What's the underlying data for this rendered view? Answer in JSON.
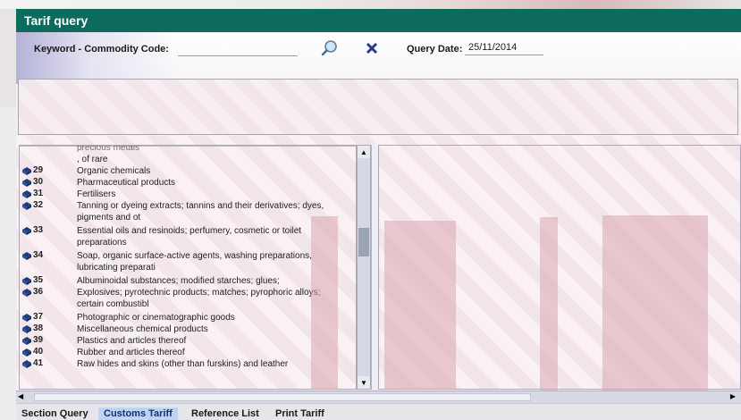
{
  "window": {
    "title": "Tarif query"
  },
  "search": {
    "keyword_label": "Keyword - Commodity Code:",
    "keyword_value": "",
    "query_date_label": "Query Date:",
    "query_date_value": "25/11/2014"
  },
  "colors": {
    "titlebar": "#0d6b5e",
    "active_tab": "#bfd3f3"
  },
  "icons": {
    "search": "magnifier-icon",
    "clear": "clear-x-icon",
    "row": "book-icon"
  },
  "chapters": [
    {
      "code": "",
      "text": "precious metals",
      "partial": true
    },
    {
      "code": "",
      "text": ", of rare"
    },
    {
      "code": "29",
      "text": "Organic chemicals"
    },
    {
      "code": "30",
      "text": "Pharmaceutical products"
    },
    {
      "code": "31",
      "text": "Fertilisers"
    },
    {
      "code": "32",
      "text": "Tanning or dyeing extracts; tannins and their derivatives; dyes, pigments and ot"
    },
    {
      "code": "33",
      "text": "Essential oils and resinoids; perfumery, cosmetic or toilet preparations"
    },
    {
      "code": "34",
      "text": "Soap, organic surface-active agents, washing preparations, lubricating preparati"
    },
    {
      "code": "35",
      "text": "Albuminoidal substances; modified starches; glues;"
    },
    {
      "code": "36",
      "text": "Explosives; pyrotechnic products; matches; pyrophoric alloys; certain combustibl"
    },
    {
      "code": "37",
      "text": "Photographic or cinematographic goods"
    },
    {
      "code": "38",
      "text": "Miscellaneous chemical products"
    },
    {
      "code": "39",
      "text": "Plastics and articles thereof"
    },
    {
      "code": "40",
      "text": "Rubber and articles thereof"
    },
    {
      "code": "41",
      "text": "Raw hides and skins (other than furskins) and leather"
    }
  ],
  "tabs": [
    {
      "label": "Section Query",
      "active": false
    },
    {
      "label": "Customs Tariff",
      "active": true
    },
    {
      "label": "Reference List",
      "active": false
    },
    {
      "label": "Print Tariff",
      "active": false
    }
  ]
}
